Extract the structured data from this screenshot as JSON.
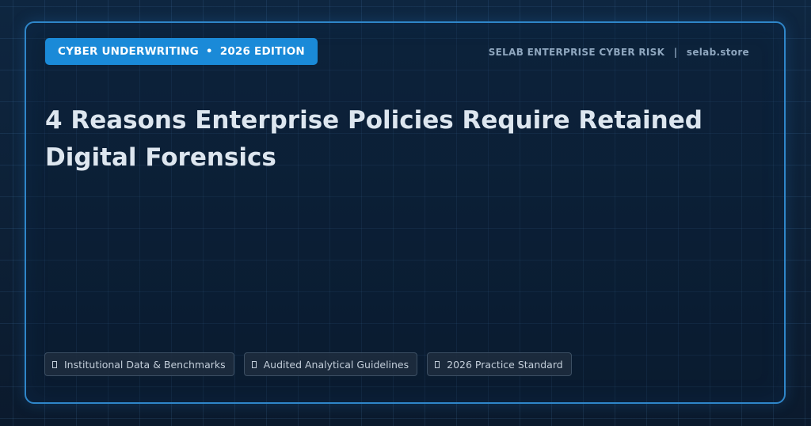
{
  "header": {
    "category": "CYBER UNDERWRITING",
    "separator": "•",
    "edition": "2026 EDITION",
    "brand_name": "SELAB ENTERPRISE CYBER RISK",
    "brand_divider": "|",
    "brand_site": "selab.store"
  },
  "main": {
    "title": "4 Reasons Enterprise Policies Require Retained Digital Forensics"
  },
  "tags": [
    {
      "label": "Institutional Data & Benchmarks",
      "icon": "document-icon"
    },
    {
      "label": "Audited Analytical Guidelines",
      "icon": "document-icon"
    },
    {
      "label": "2026 Practice Standard",
      "icon": "document-icon"
    }
  ],
  "colors": {
    "accent": "#1a8ad8",
    "frame": "#2f86c9",
    "background": "#0d2036",
    "title_text": "#dde6ef"
  }
}
